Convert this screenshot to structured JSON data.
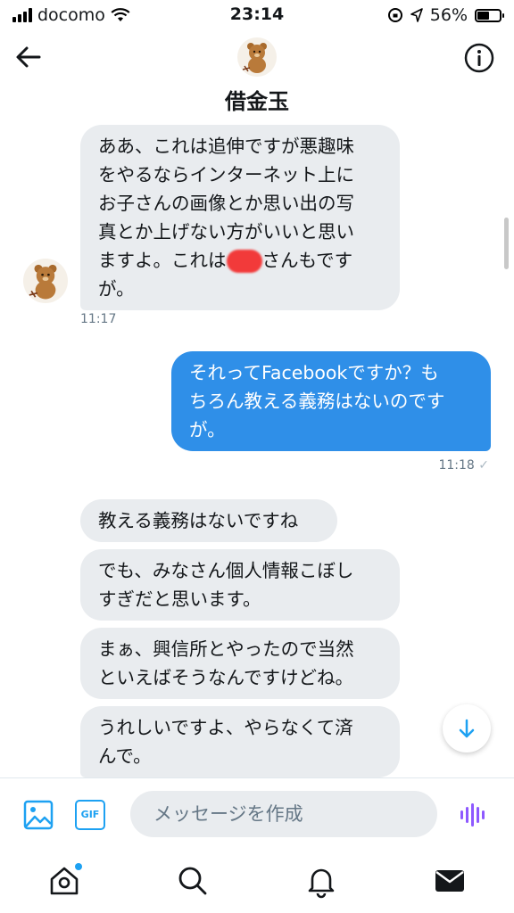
{
  "status_bar": {
    "carrier": "docomo",
    "time": "23:14",
    "battery": "56%",
    "battery_level": 0.56
  },
  "header": {
    "name": "借金玉"
  },
  "messages": [
    {
      "lines": [
        "ああ、これは追伸ですが悪趣味",
        "をやるならインターネット上に",
        "お子さんの画像とか思い出の写",
        "真とか上げない方がいいと思い"
      ],
      "line5_before": "ますよ。これは",
      "line5_after": "さんもです",
      "line6": "が。"
    },
    {
      "lines": [
        "それってFacebookですか？も",
        "ちろん教える義務はないのです",
        "が。"
      ]
    },
    {
      "lines": [
        "教える義務はないですね"
      ]
    },
    {
      "lines": [
        "でも、みなさん個人情報こぼし",
        "すぎだと思います。"
      ]
    },
    {
      "lines": [
        "まぁ、興信所とやったので当然",
        "といえばそうなんですけどね。"
      ]
    },
    {
      "lines": [
        "うれしいですよ、やらなくて済",
        "んで。"
      ]
    }
  ],
  "timestamps": {
    "first": "11:17",
    "sent": "11:18",
    "sent_check": "✓"
  },
  "compose": {
    "gif_label": "GIF",
    "placeholder": "メッセージを作成"
  },
  "colors": {
    "accent": "#1da1f2",
    "sent_bubble": "#2f8fe8",
    "received_bubble": "#e9ecef",
    "voice": "#8e59ff"
  }
}
